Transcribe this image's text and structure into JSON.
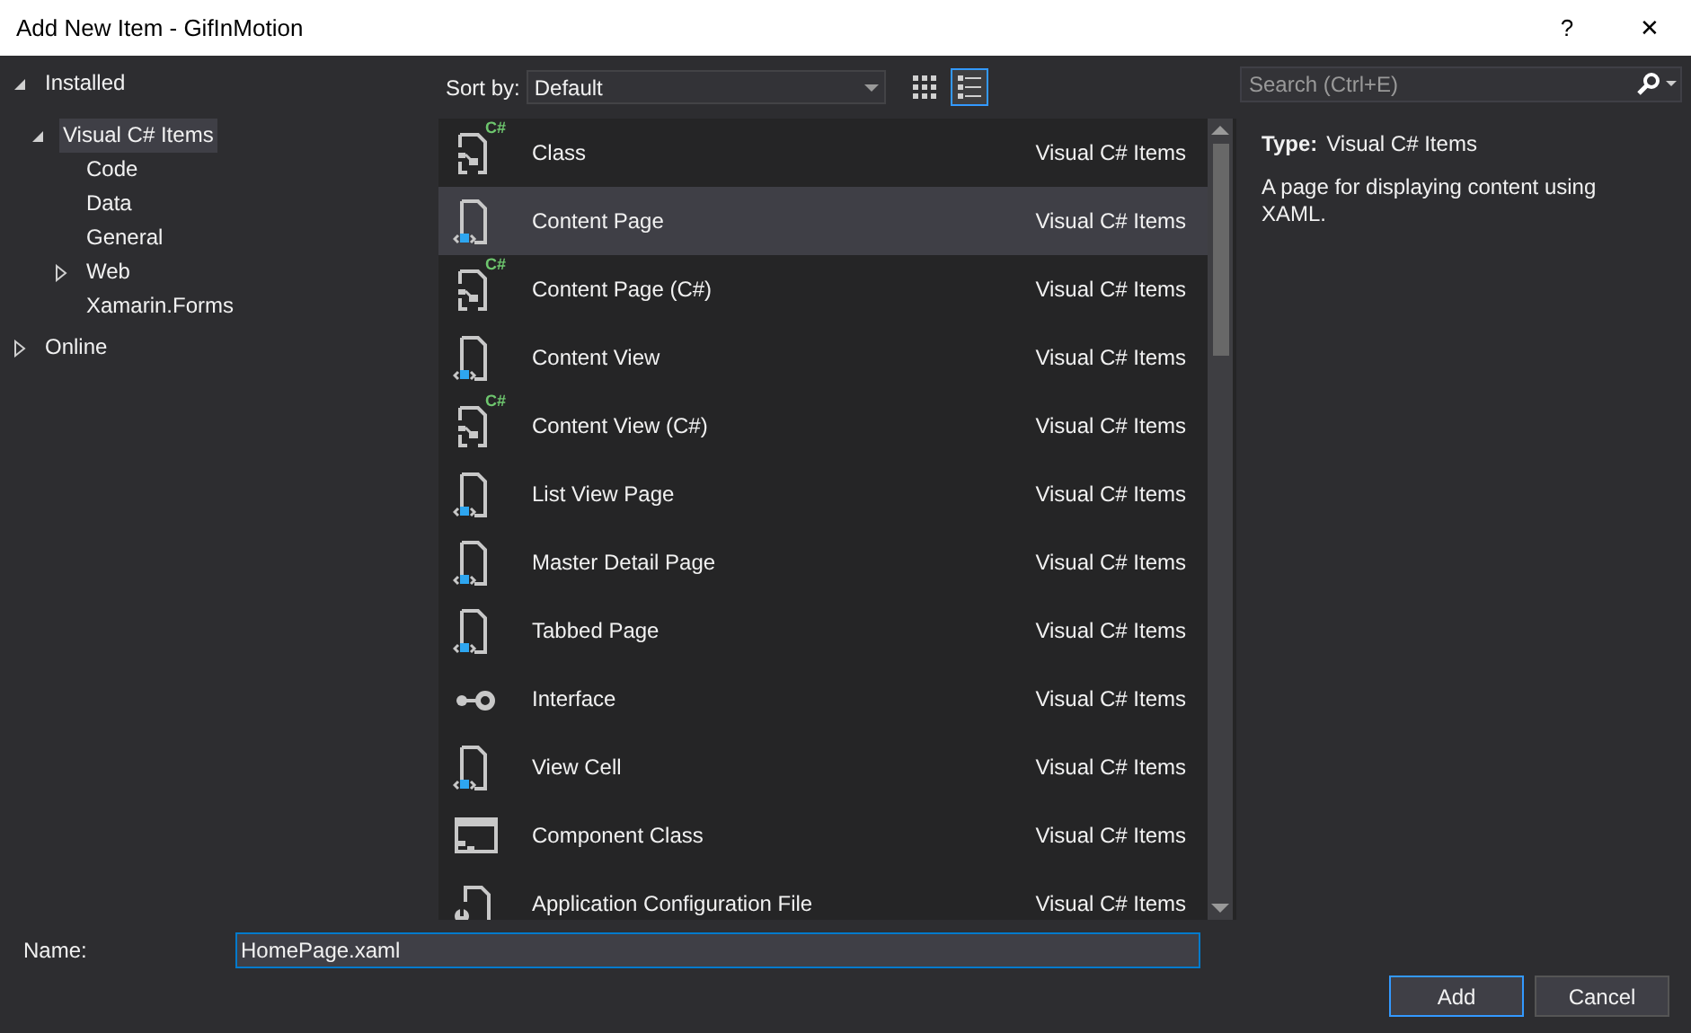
{
  "window": {
    "title": "Add New Item - GifInMotion"
  },
  "title_buttons": [
    "?",
    "✕"
  ],
  "tree": [
    {
      "label": "Installed",
      "expanded": true,
      "selected": false,
      "children": [
        {
          "label": "Visual C# Items",
          "expanded": true,
          "selected": true,
          "children": [
            {
              "label": "Code",
              "selected": false
            },
            {
              "label": "Data",
              "selected": false
            },
            {
              "label": "General",
              "selected": false
            },
            {
              "label": "Web",
              "expanded": false,
              "selected": false
            },
            {
              "label": "Xamarin.Forms",
              "selected": false
            }
          ]
        }
      ]
    },
    {
      "label": "Online",
      "expanded": false,
      "selected": false
    }
  ],
  "toolbar": {
    "sort_label": "Sort by:",
    "sort_value": "Default",
    "view_buttons": [
      {
        "kind": "grid",
        "selected": false
      },
      {
        "kind": "list",
        "selected": true
      }
    ]
  },
  "search": {
    "placeholder": "Search (Ctrl+E)"
  },
  "templates": [
    {
      "name": "Class",
      "category": "Visual C# Items",
      "kind": "cs",
      "badge": "C#",
      "selected": false
    },
    {
      "name": "Content Page",
      "category": "Visual C# Items",
      "kind": "xaml",
      "selected": true
    },
    {
      "name": "Content Page (C#)",
      "category": "Visual C# Items",
      "kind": "cs",
      "badge": "C#",
      "selected": false
    },
    {
      "name": "Content View",
      "category": "Visual C# Items",
      "kind": "xaml",
      "selected": false
    },
    {
      "name": "Content View (C#)",
      "category": "Visual C# Items",
      "kind": "cs",
      "badge": "C#",
      "selected": false
    },
    {
      "name": "List View Page",
      "category": "Visual C# Items",
      "kind": "xaml",
      "selected": false
    },
    {
      "name": "Master Detail Page",
      "category": "Visual C# Items",
      "kind": "xaml",
      "selected": false
    },
    {
      "name": "Tabbed Page",
      "category": "Visual C# Items",
      "kind": "xaml",
      "selected": false
    },
    {
      "name": "Interface",
      "category": "Visual C# Items",
      "kind": "interface",
      "selected": false
    },
    {
      "name": "View Cell",
      "category": "Visual C# Items",
      "kind": "xaml",
      "selected": false
    },
    {
      "name": "Component Class",
      "category": "Visual C# Items",
      "kind": "component",
      "selected": false
    },
    {
      "name": "Application Configuration File",
      "category": "Visual C# Items",
      "kind": "config",
      "selected": false
    }
  ],
  "details": {
    "type_label": "Type:",
    "type_value": "Visual C# Items",
    "description": "A page for displaying content using XAML."
  },
  "name_field": {
    "label": "Name:",
    "value": "HomePage.xaml"
  },
  "buttons": [
    {
      "label": "Add",
      "default": true
    },
    {
      "label": "Cancel",
      "default": false
    }
  ]
}
